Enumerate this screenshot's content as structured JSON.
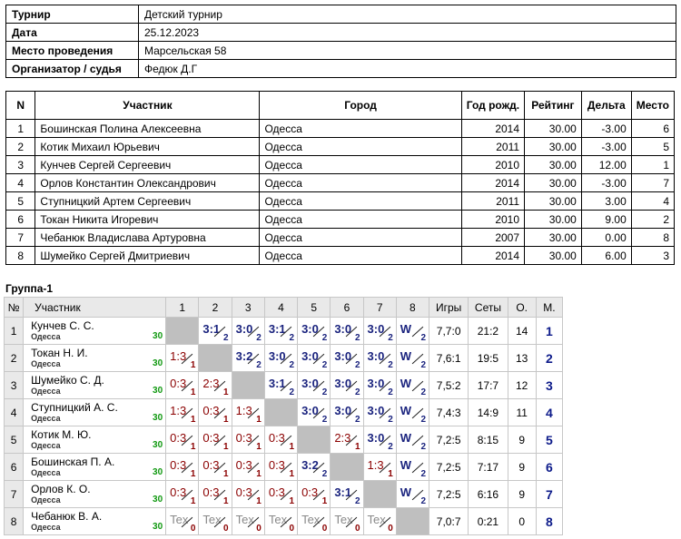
{
  "info": [
    {
      "key": "Турнир",
      "value": "Детский турнир"
    },
    {
      "key": "Дата",
      "value": "25.12.2023"
    },
    {
      "key": "Место проведения",
      "value": "Марсельская 58"
    },
    {
      "key": "Организатор / судья",
      "value": "Федюк Д.Г"
    }
  ],
  "players_headers": {
    "n": "N",
    "name": "Участник",
    "city": "Город",
    "year": "Год рожд.",
    "rating": "Рейтинг",
    "delta": "Дельта",
    "place": "Место"
  },
  "players": [
    {
      "n": "1",
      "name": "Бошинская Полина Алексеевна",
      "city": "Одесса",
      "year": "2014",
      "rating": "30.00",
      "delta": "-3.00",
      "place": "6"
    },
    {
      "n": "2",
      "name": "Котик Михаил Юрьевич",
      "city": "Одесса",
      "year": "2011",
      "rating": "30.00",
      "delta": "-3.00",
      "place": "5"
    },
    {
      "n": "3",
      "name": "Кунчев Сергей Сергеевич",
      "city": "Одесса",
      "year": "2010",
      "rating": "30.00",
      "delta": "12.00",
      "place": "1"
    },
    {
      "n": "4",
      "name": "Орлов Константин Олександрович",
      "city": "Одесса",
      "year": "2014",
      "rating": "30.00",
      "delta": "-3.00",
      "place": "7"
    },
    {
      "n": "5",
      "name": "Ступницкий Артем Сергеевич",
      "city": "Одесса",
      "year": "2011",
      "rating": "30.00",
      "delta": "3.00",
      "place": "4"
    },
    {
      "n": "6",
      "name": "Токан Никита Игоревич",
      "city": "Одесса",
      "year": "2010",
      "rating": "30.00",
      "delta": "9.00",
      "place": "2"
    },
    {
      "n": "7",
      "name": "Чебанюк Владислава Артуровна",
      "city": "Одесса",
      "year": "2007",
      "rating": "30.00",
      "delta": "0.00",
      "place": "8"
    },
    {
      "n": "8",
      "name": "Шумейко Сергей Дмитриевич",
      "city": "Одесса",
      "year": "2014",
      "rating": "30.00",
      "delta": "6.00",
      "place": "3"
    }
  ],
  "group": {
    "title": "Группа-1",
    "headers": {
      "n": "№",
      "player": "Участник",
      "cols": [
        "1",
        "2",
        "3",
        "4",
        "5",
        "6",
        "7",
        "8"
      ],
      "games": "Игры",
      "sets": "Сеты",
      "points": "О.",
      "place": "М."
    },
    "rows": [
      {
        "n": "1",
        "name": "Кунчев С. С.",
        "city": "Одесса",
        "rating": "30",
        "cells": [
          null,
          [
            "3:1",
            "2"
          ],
          [
            "3:0",
            "2"
          ],
          [
            "3:1",
            "2"
          ],
          [
            "3:0",
            "2"
          ],
          [
            "3:0",
            "2"
          ],
          [
            "3:0",
            "2"
          ],
          [
            "W",
            "2"
          ]
        ],
        "games": "7,7:0",
        "sets": "21:2",
        "points": "14",
        "place": "1"
      },
      {
        "n": "2",
        "name": "Токан Н. И.",
        "city": "Одесса",
        "rating": "30",
        "cells": [
          [
            "1:3",
            "1"
          ],
          null,
          [
            "3:2",
            "2"
          ],
          [
            "3:0",
            "2"
          ],
          [
            "3:0",
            "2"
          ],
          [
            "3:0",
            "2"
          ],
          [
            "3:0",
            "2"
          ],
          [
            "W",
            "2"
          ]
        ],
        "games": "7,6:1",
        "sets": "19:5",
        "points": "13",
        "place": "2"
      },
      {
        "n": "3",
        "name": "Шумейко С. Д.",
        "city": "Одесса",
        "rating": "30",
        "cells": [
          [
            "0:3",
            "1"
          ],
          [
            "2:3",
            "1"
          ],
          null,
          [
            "3:1",
            "2"
          ],
          [
            "3:0",
            "2"
          ],
          [
            "3:0",
            "2"
          ],
          [
            "3:0",
            "2"
          ],
          [
            "W",
            "2"
          ]
        ],
        "games": "7,5:2",
        "sets": "17:7",
        "points": "12",
        "place": "3"
      },
      {
        "n": "4",
        "name": "Ступницкий А. С.",
        "city": "Одесса",
        "rating": "30",
        "cells": [
          [
            "1:3",
            "1"
          ],
          [
            "0:3",
            "1"
          ],
          [
            "1:3",
            "1"
          ],
          null,
          [
            "3:0",
            "2"
          ],
          [
            "3:0",
            "2"
          ],
          [
            "3:0",
            "2"
          ],
          [
            "W",
            "2"
          ]
        ],
        "games": "7,4:3",
        "sets": "14:9",
        "points": "11",
        "place": "4"
      },
      {
        "n": "5",
        "name": "Котик М. Ю.",
        "city": "Одесса",
        "rating": "30",
        "cells": [
          [
            "0:3",
            "1"
          ],
          [
            "0:3",
            "1"
          ],
          [
            "0:3",
            "1"
          ],
          [
            "0:3",
            "1"
          ],
          null,
          [
            "2:3",
            "1"
          ],
          [
            "3:0",
            "2"
          ],
          [
            "W",
            "2"
          ]
        ],
        "games": "7,2:5",
        "sets": "8:15",
        "points": "9",
        "place": "5"
      },
      {
        "n": "6",
        "name": "Бошинская П. А.",
        "city": "Одесса",
        "rating": "30",
        "cells": [
          [
            "0:3",
            "1"
          ],
          [
            "0:3",
            "1"
          ],
          [
            "0:3",
            "1"
          ],
          [
            "0:3",
            "1"
          ],
          [
            "3:2",
            "2"
          ],
          null,
          [
            "1:3",
            "1"
          ],
          [
            "W",
            "2"
          ]
        ],
        "games": "7,2:5",
        "sets": "7:17",
        "points": "9",
        "place": "6"
      },
      {
        "n": "7",
        "name": "Орлов К. О.",
        "city": "Одесса",
        "rating": "30",
        "cells": [
          [
            "0:3",
            "1"
          ],
          [
            "0:3",
            "1"
          ],
          [
            "0:3",
            "1"
          ],
          [
            "0:3",
            "1"
          ],
          [
            "0:3",
            "1"
          ],
          [
            "3:1",
            "2"
          ],
          null,
          [
            "W",
            "2"
          ]
        ],
        "games": "7,2:5",
        "sets": "6:16",
        "points": "9",
        "place": "7"
      },
      {
        "n": "8",
        "name": "Чебанюк В. А.",
        "city": "Одесса",
        "rating": "30",
        "cells": [
          [
            "Tex",
            "0"
          ],
          [
            "Tex",
            "0"
          ],
          [
            "Tex",
            "0"
          ],
          [
            "Tex",
            "0"
          ],
          [
            "Tex",
            "0"
          ],
          [
            "Tex",
            "0"
          ],
          [
            "Tex",
            "0"
          ],
          null
        ],
        "games": "7,0:7",
        "sets": "0:21",
        "points": "0",
        "place": "8"
      }
    ]
  }
}
